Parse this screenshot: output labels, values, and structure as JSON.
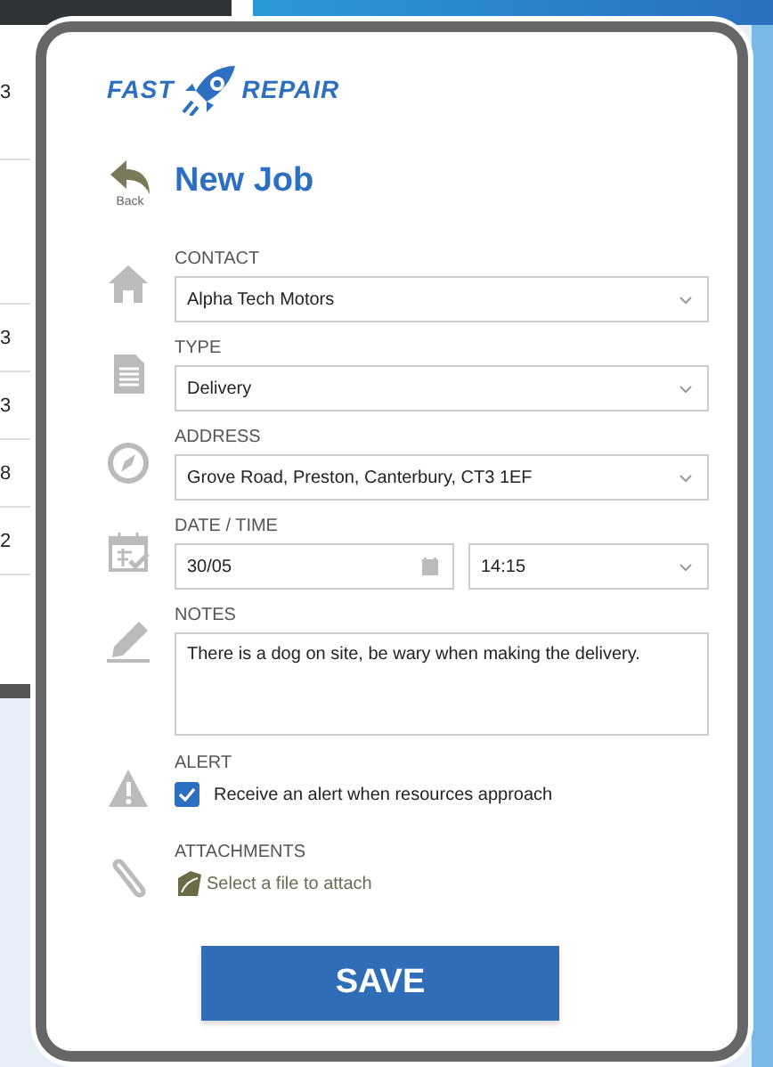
{
  "background_cells": [
    "3",
    "3",
    "3",
    "8",
    "2"
  ],
  "logo": {
    "left": "FAST",
    "right": "REPAIR"
  },
  "back": "Back",
  "title": "New Job",
  "fields": [
    {
      "kind": "select",
      "label": "CONTACT",
      "value": "Alpha Tech Motors"
    },
    {
      "kind": "select",
      "label": "TYPE",
      "value": "Delivery"
    },
    {
      "kind": "select",
      "label": "ADDRESS",
      "value": "Grove Road, Preston, Canterbury, CT3 1EF"
    },
    {
      "kind": "datetime",
      "label": "DATE / TIME",
      "date": "30/05",
      "time": "14:15"
    },
    {
      "kind": "textarea",
      "label": "NOTES",
      "value": "There is a dog on site, be wary when making the delivery."
    },
    {
      "kind": "checkbox",
      "label": "ALERT",
      "text": "Receive an alert when resources approach",
      "checked": true
    },
    {
      "kind": "file",
      "label": "ATTACHMENTS",
      "link": "Select a file to attach"
    }
  ],
  "save": "SAVE"
}
